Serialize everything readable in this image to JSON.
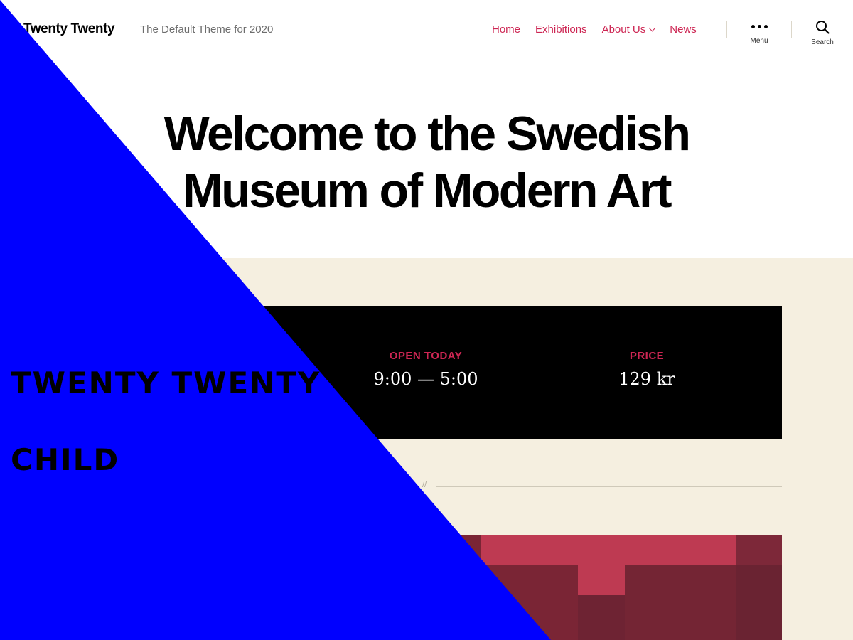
{
  "header": {
    "site_title": "Twenty Twenty",
    "site_description": "The Default Theme for 2020",
    "nav": [
      {
        "label": "Home"
      },
      {
        "label": "Exhibitions"
      },
      {
        "label": "About Us",
        "has_submenu": true
      },
      {
        "label": "News"
      }
    ],
    "menu_label": "Menu",
    "search_label": "Search"
  },
  "hero": {
    "title_line1": "Welcome to the Swedish",
    "title_line2": "Museum of Modern Art"
  },
  "info": {
    "open_today_heading": "OPEN TODAY",
    "open_today_value": "9:00 — 5:00",
    "price_heading": "PRICE",
    "price_value": "129 kr"
  },
  "overlay": {
    "line1": "TWENTY TWENTY",
    "line2": "CHILD"
  },
  "colors": {
    "accent": "#cd2653",
    "overlay": "#0000ff",
    "cover_bg": "#f5efe0"
  }
}
